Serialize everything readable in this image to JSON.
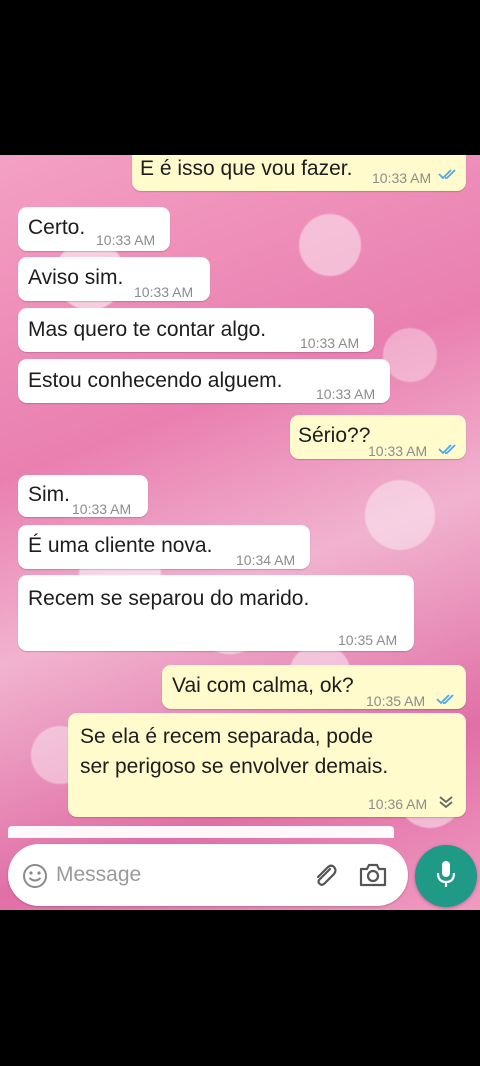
{
  "chat": {
    "messages": [
      {
        "direction": "out",
        "text": "E é isso que vou fazer.",
        "time": "10:33 AM",
        "status": "read"
      },
      {
        "direction": "in",
        "text": "Certo.",
        "time": "10:33 AM"
      },
      {
        "direction": "in",
        "text": "Aviso sim.",
        "time": "10:33 AM"
      },
      {
        "direction": "in",
        "text": "Mas quero te contar algo.",
        "time": "10:33 AM"
      },
      {
        "direction": "in",
        "text": "Estou conhecendo alguem.",
        "time": "10:33 AM"
      },
      {
        "direction": "out",
        "text": "Sério??",
        "time": "10:33 AM",
        "status": "read"
      },
      {
        "direction": "in",
        "text": "Sim.",
        "time": "10:33 AM"
      },
      {
        "direction": "in",
        "text": "É uma cliente nova.",
        "time": "10:34 AM"
      },
      {
        "direction": "in",
        "text": "Recem se separou do marido.",
        "time": "10:35 AM"
      },
      {
        "direction": "out",
        "text": "Vai com calma, ok?",
        "time": "10:35 AM",
        "status": "read"
      },
      {
        "direction": "out",
        "text_line1": "Se ela é recem separada, pode",
        "text_line2": "ser perigoso se envolver demais.",
        "time": "10:36 AM"
      }
    ]
  },
  "composer": {
    "placeholder": "Message",
    "icons": [
      "emoji-icon",
      "attach-icon",
      "camera-icon",
      "mic-icon",
      "scroll-down-icon"
    ]
  },
  "colors": {
    "incoming_bubble": "#ffffff",
    "outgoing_bubble": "#fffbcc",
    "read_ticks": "#4fa8e8",
    "mic_button": "#1f9a86"
  }
}
